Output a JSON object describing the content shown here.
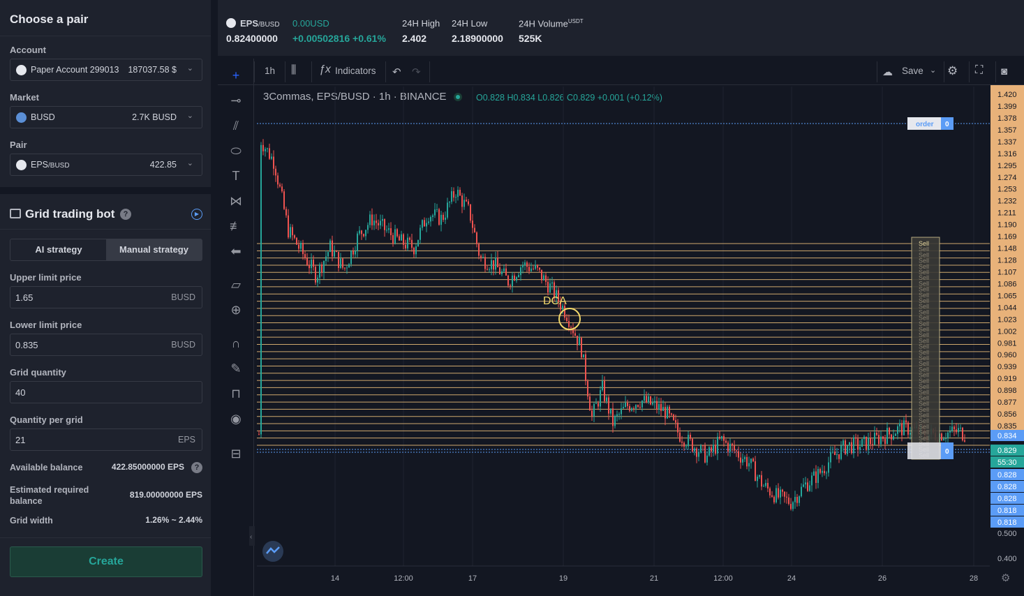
{
  "left_panel": {
    "title": "Choose a pair",
    "account": {
      "label": "Account",
      "name": "Paper Account 299013",
      "value": "187037.58 $"
    },
    "market": {
      "label": "Market",
      "name": "BUSD",
      "value": "2.7K BUSD"
    },
    "pair": {
      "label": "Pair",
      "name": "EPS",
      "quote": "/BUSD",
      "value": "422.85"
    },
    "bot": {
      "title": "Grid trading bot",
      "tab_ai": "AI strategy",
      "tab_manual": "Manual strategy",
      "upper_label": "Upper limit price",
      "upper_value": "1.65",
      "upper_unit": "BUSD",
      "lower_label": "Lower limit price",
      "lower_value": "0.835",
      "lower_unit": "BUSD",
      "grid_qty_label": "Grid quantity",
      "grid_qty_value": "40",
      "qty_per_grid_label": "Quantity per grid",
      "qty_per_grid_value": "21",
      "qty_per_grid_unit": "EPS",
      "available_label": "Available balance",
      "available_value": "422.85000000 EPS",
      "est_label": "Estimated required balance",
      "est_value": "819.00000000 EPS",
      "grid_width_label": "Grid width",
      "grid_width_value": "1.26% ~ 2.44%",
      "create_label": "Create"
    }
  },
  "header": {
    "pair": "EPS",
    "pair_quote": "/BUSD",
    "price": "0.82400000",
    "usd": "0.00USD",
    "change": "+0.00502816 +0.61%",
    "high_label": "24H High",
    "high": "2.402",
    "low_label": "24H Low",
    "low": "2.18900000",
    "vol_label": "24H Volume",
    "vol_sup": "USDT",
    "vol": "525K"
  },
  "toolbar": {
    "interval": "1h",
    "indicators": "Indicators",
    "save": "Save"
  },
  "legend": {
    "text": "3Commas, EPS/BUSD · 1h · BINANCE",
    "ohlc": "O0.828  H0.834  L0.826  C0.829  +0.001 (+0.12%)"
  },
  "chart_data": {
    "type": "candlestick",
    "annotation": "DCA",
    "order_label": "order",
    "order_count": "0",
    "sell_label": "Sell",
    "sell_count": "0",
    "y_ticks": [
      "1.420",
      "1.399",
      "1.378",
      "1.357",
      "1.337",
      "1.316",
      "1.295",
      "1.274",
      "1.253",
      "1.232",
      "1.211",
      "1.190",
      "1.169",
      "1.148",
      "1.128",
      "1.107",
      "1.086",
      "1.065",
      "1.044",
      "1.023",
      "1.002",
      "0.981",
      "0.960",
      "0.939",
      "0.919",
      "0.898",
      "0.877",
      "0.856",
      "0.835"
    ],
    "y_price_labels": [
      "0.834",
      "0.829",
      "55:30",
      "0.828",
      "0.828",
      "0.828",
      "0.818",
      "0.818",
      "0.500",
      "0.400"
    ],
    "x_ticks": [
      "14",
      "12:00",
      "17",
      "19",
      "21",
      "12:00",
      "24",
      "26",
      "28"
    ],
    "colors": {
      "up": "#26a69a",
      "down": "#ef5350",
      "grid": "#f0c27b",
      "axis": "#e8b27a"
    }
  }
}
